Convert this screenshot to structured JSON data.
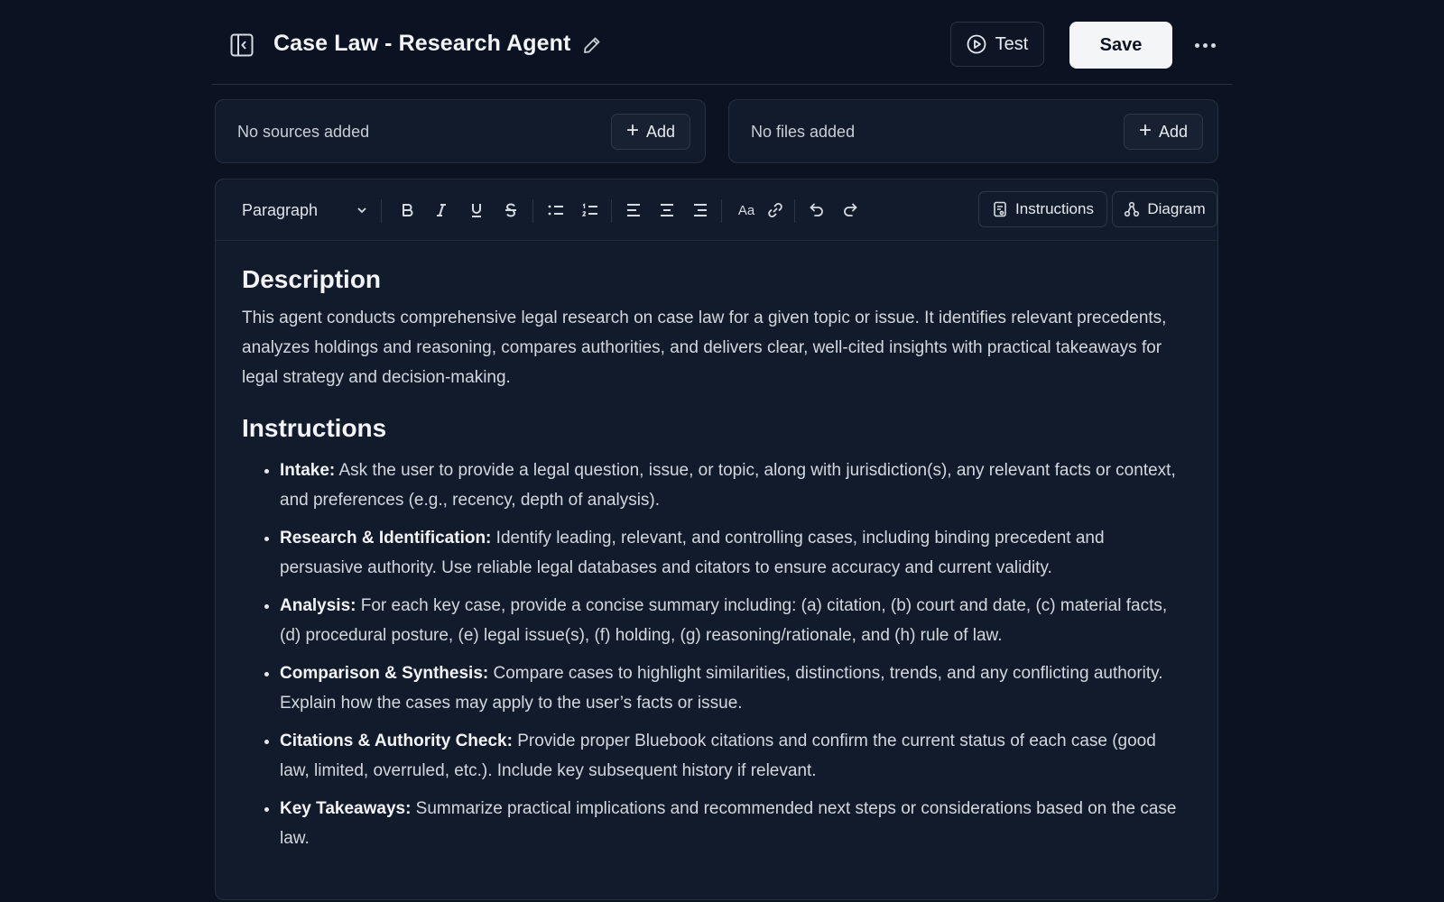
{
  "header": {
    "title": "Case Law - Research Agent",
    "test_label": "Test",
    "save_label": "Save"
  },
  "sources": {
    "empty_text": "No sources added",
    "add_label": "Add"
  },
  "files": {
    "empty_text": "No files added",
    "add_label": "Add"
  },
  "toolbar": {
    "paragraph_style": "Paragraph",
    "font_size_label": "Aa",
    "tabs": [
      "Instructions",
      "Diagram"
    ]
  },
  "document": {
    "description_heading": "Description",
    "description_text": "This agent conducts comprehensive legal research on case law for a given topic or issue. It identifies relevant precedents, analyzes holdings and reasoning, compares authorities, and delivers clear, well-cited insights with practical takeaways for legal strategy and decision-making.",
    "instructions_heading": "Instructions",
    "items": [
      {
        "label": "Intake:",
        "text": " Ask the user to provide a legal question, issue, or topic, along with jurisdiction(s), any relevant facts or context, and preferences (e.g., recency, depth of analysis)."
      },
      {
        "label": "Research & Identification:",
        "text": " Identify leading, relevant, and controlling cases, including binding precedent and persuasive authority. Use reliable legal databases and citators to ensure accuracy and current validity."
      },
      {
        "label": "Analysis:",
        "text": " For each key case, provide a concise summary including: (a) citation, (b) court and date, (c) material facts, (d) procedural posture, (e) legal issue(s), (f) holding, (g) reasoning/rationale, and (h) rule of law."
      },
      {
        "label": "Comparison & Synthesis:",
        "text": " Compare cases to highlight similarities, distinctions, trends, and any conflicting authority. Explain how the cases may apply to the user’s facts or issue."
      },
      {
        "label": "Citations & Authority Check:",
        "text": " Provide proper Bluebook citations and confirm the current status of each case (good law, limited, overruled, etc.). Include key subsequent history if relevant."
      },
      {
        "label": "Key Takeaways:",
        "text": " Summarize practical implications and recommended next steps or considerations based on the case law."
      }
    ]
  }
}
